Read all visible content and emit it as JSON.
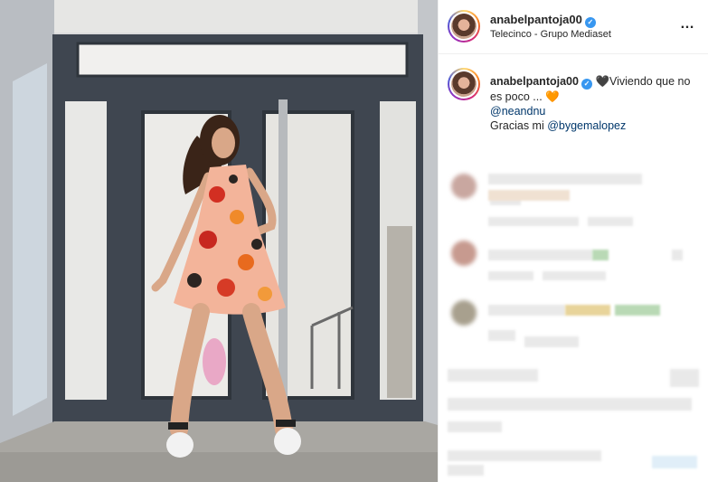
{
  "post": {
    "username": "anabelpantoja00",
    "location": "Telecinco - Grupo Mediaset",
    "more_icon": "…",
    "verified_badge": "✓"
  },
  "caption": {
    "username": "anabelpantoja00",
    "verified_badge": "✓",
    "heart_black": "🖤",
    "text_1": "Viviendo que no es poco ...",
    "heart_orange": "🧡",
    "mention_1": "@neandnu",
    "thanks_text": "Gracias mi",
    "mention_2": "@bygemalopez"
  },
  "colors": {
    "accent_link": "#00376b",
    "verified": "#3897f0",
    "heart_orange": "#f0821e"
  }
}
